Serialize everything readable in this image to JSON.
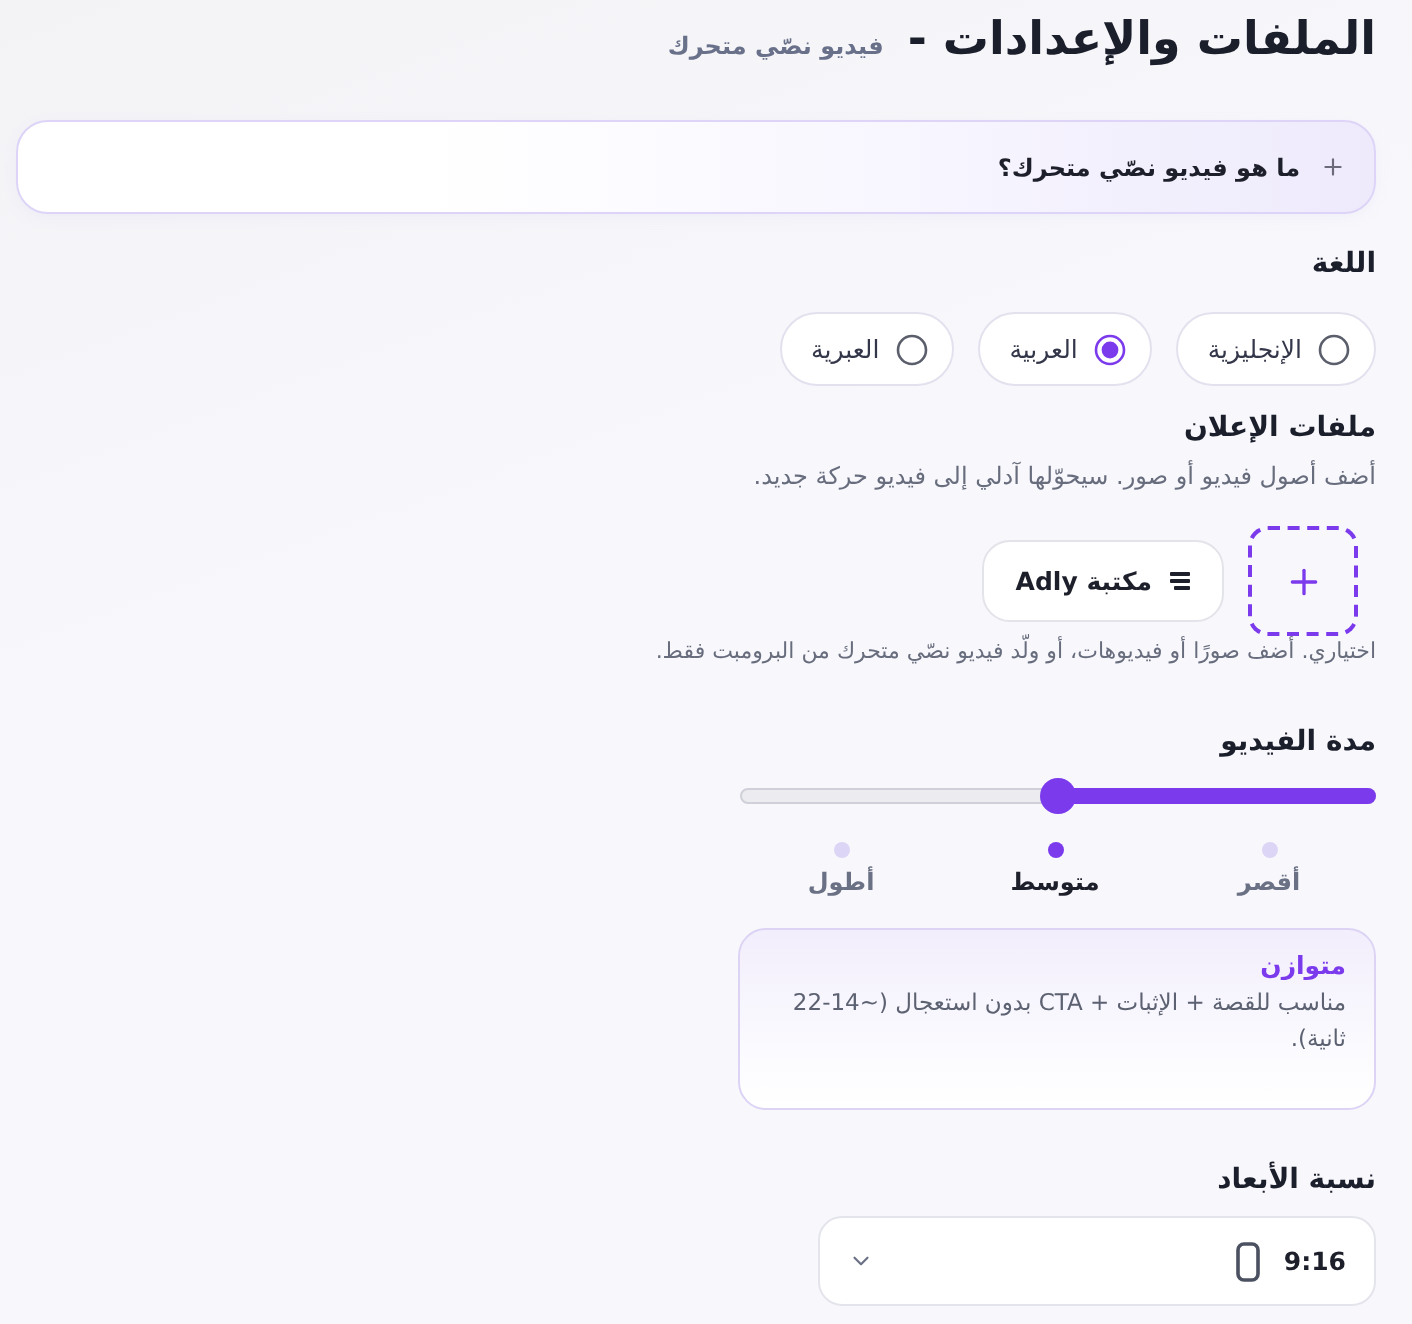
{
  "header": {
    "title": "الملفات والإعدادات -",
    "subtitle": "فيديو نصّي متحرك"
  },
  "faq": {
    "question": "ما هو فيديو نصّي متحرك؟",
    "expanded": false
  },
  "language": {
    "label": "اللغة",
    "options": [
      {
        "label": "الإنجليزية",
        "selected": false
      },
      {
        "label": "العربية",
        "selected": true
      },
      {
        "label": "العبرية",
        "selected": false
      }
    ]
  },
  "ad_files": {
    "label": "ملفات الإعلان",
    "description": "أضف أصول فيديو أو صور. سيحوّلها آدلي إلى فيديو حركة جديد.",
    "library_button": "مكتبة Adly",
    "hint": "اختياري. أضف صورًا أو فيديوهات، أو ولّد فيديو نصّي متحرك من البرومبت فقط."
  },
  "duration": {
    "label": "مدة الفيديو",
    "level": 0.5,
    "stops": [
      {
        "label": "أقصر",
        "selected": false
      },
      {
        "label": "متوسط",
        "selected": true
      },
      {
        "label": "أطول",
        "selected": false
      }
    ],
    "info": {
      "title": "متوازن",
      "text": "مناسب للقصة + الإثبات + CTA بدون استعجال (~14-22 ثانية)."
    }
  },
  "aspect_ratio": {
    "label": "نسبة الأبعاد",
    "value": "9:16"
  }
}
